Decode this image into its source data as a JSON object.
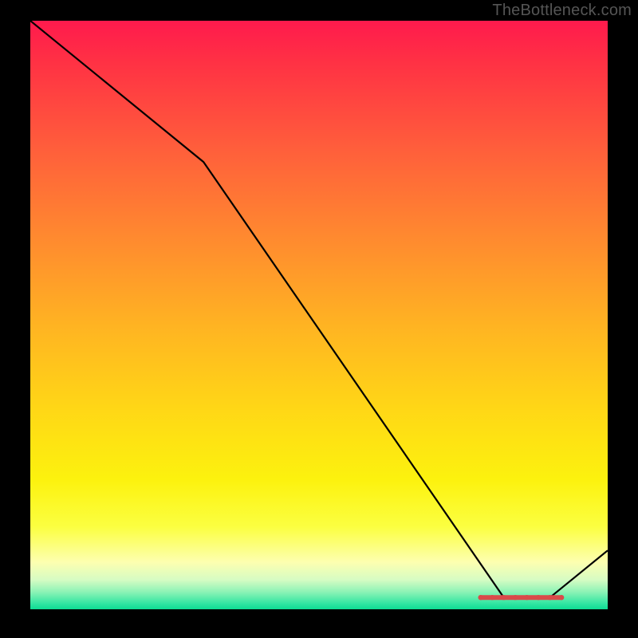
{
  "watermark": "TheBottleneck.com",
  "chart_data": {
    "type": "line",
    "x": [
      0.0,
      0.3,
      0.82,
      0.9,
      1.0
    ],
    "values": [
      1.0,
      0.76,
      0.02,
      0.02,
      0.1
    ],
    "xlim": [
      0,
      1
    ],
    "ylim": [
      0,
      1
    ],
    "xlabel": "",
    "ylabel": "",
    "title": "",
    "background_gradient": {
      "top": "#ff1a4d",
      "mid": "#ffd716",
      "bottom": "#0edc93"
    },
    "marker_band": {
      "y": 0.02,
      "x_start": 0.78,
      "x_end": 0.92,
      "color": "#d94a4a"
    }
  }
}
